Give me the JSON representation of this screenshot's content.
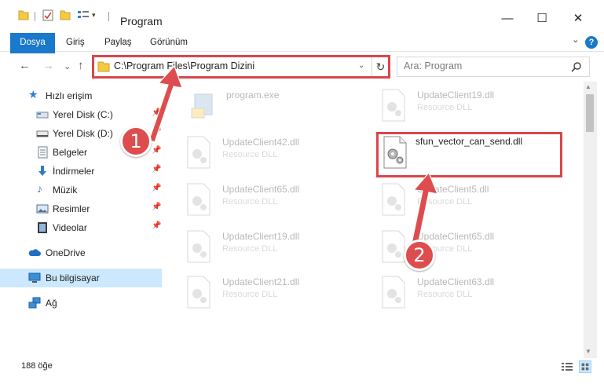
{
  "window": {
    "title": "Program",
    "controls": {
      "minimize": "—",
      "maximize": "☐",
      "close": "✕"
    }
  },
  "ribbon": {
    "tabs": [
      "Dosya",
      "Giriş",
      "Paylaş",
      "Görünüm"
    ],
    "help": "?",
    "collapse": "⌄"
  },
  "nav": {
    "back": "←",
    "forward": "→",
    "recent": "⌄",
    "up": "↑",
    "address": "C:\\Program Files\\Program Dizini",
    "refresh": "↻",
    "search_placeholder": "Ara: Program"
  },
  "sidebar": {
    "items": [
      {
        "label": "Hızlı erişim",
        "icon": "star-icon",
        "pinned": false,
        "selected": false
      },
      {
        "label": "Yerel Disk (C:)",
        "icon": "drive-c-icon",
        "pinned": true,
        "selected": false
      },
      {
        "label": "Yerel Disk (D:)",
        "icon": "drive-d-icon",
        "pinned": true,
        "selected": false
      },
      {
        "label": "Belgeler",
        "icon": "documents-icon",
        "pinned": true,
        "selected": false
      },
      {
        "label": "İndirmeler",
        "icon": "downloads-icon",
        "pinned": true,
        "selected": false
      },
      {
        "label": "Müzik",
        "icon": "music-icon",
        "pinned": true,
        "selected": false
      },
      {
        "label": "Resimler",
        "icon": "pictures-icon",
        "pinned": true,
        "selected": false
      },
      {
        "label": "Videolar",
        "icon": "videos-icon",
        "pinned": true,
        "selected": false
      },
      {
        "label": "OneDrive",
        "icon": "onedrive-icon",
        "pinned": false,
        "selected": false
      },
      {
        "label": "Bu bilgisayar",
        "icon": "this-pc-icon",
        "pinned": false,
        "selected": true
      },
      {
        "label": "Ağ",
        "icon": "network-icon",
        "pinned": false,
        "selected": false
      }
    ]
  },
  "files": [
    {
      "name": "program.exe",
      "type": "",
      "icon": "program-exe-icon",
      "highlighted": false
    },
    {
      "name": "UpdateClient19.dll",
      "type": "Resource DLL",
      "icon": "dll-icon",
      "highlighted": false
    },
    {
      "name": "UpdateClient42.dll",
      "type": "Resource DLL",
      "icon": "dll-icon",
      "highlighted": false
    },
    {
      "name": "sfun_vector_can_send.dll",
      "type": "",
      "icon": "dll-gear-icon",
      "highlighted": true
    },
    {
      "name": "UpdateClient65.dll",
      "type": "Resource DLL",
      "icon": "dll-icon",
      "highlighted": false
    },
    {
      "name": "UpdateClient5.dll",
      "type": "Resource DLL",
      "icon": "dll-icon",
      "highlighted": false
    },
    {
      "name": "UpdateClient19.dll",
      "type": "Resource DLL",
      "icon": "dll-icon",
      "highlighted": false
    },
    {
      "name": "UpdateClient65.dll",
      "type": "Resource DLL",
      "icon": "dll-icon",
      "highlighted": false
    },
    {
      "name": "UpdateClient21.dll",
      "type": "Resource DLL",
      "icon": "dll-icon",
      "highlighted": false
    },
    {
      "name": "UpdateClient63.dll",
      "type": "Resource DLL",
      "icon": "dll-icon",
      "highlighted": false
    }
  ],
  "status": {
    "item_count": "188 öğe"
  },
  "annotations": {
    "callout_1": "1",
    "callout_2": "2",
    "accent": "#d8474a"
  }
}
